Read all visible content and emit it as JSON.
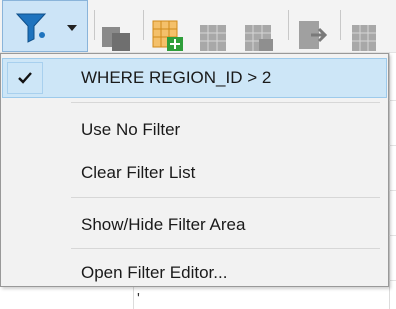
{
  "menu": {
    "items": [
      {
        "label": "WHERE REGION_ID > 2",
        "checked": true
      },
      {
        "label": "Use No Filter",
        "checked": false
      },
      {
        "label": "Clear Filter List",
        "checked": false
      },
      {
        "label": "Show/Hide Filter Area",
        "checked": false
      },
      {
        "label": "Open Filter Editor...",
        "checked": false
      }
    ]
  },
  "colors": {
    "accent": "#1e73be",
    "highlight": "#cde6f7",
    "menu_bg": "#f2f2f2"
  },
  "toolbar": {
    "icons": [
      "filter-icon",
      "dropdown-arrow-icon",
      "copy-icon",
      "table-add-icon",
      "table-icon",
      "table-edit-icon",
      "export-icon",
      "grid-icon"
    ]
  }
}
